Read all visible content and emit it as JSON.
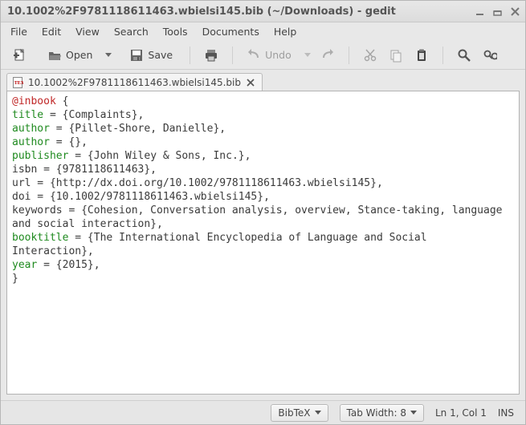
{
  "window": {
    "title": "10.1002%2F9781118611463.wbielsi145.bib (~/Downloads) - gedit"
  },
  "menubar": [
    "File",
    "Edit",
    "View",
    "Search",
    "Tools",
    "Documents",
    "Help"
  ],
  "toolbar": {
    "open_label": "Open",
    "save_label": "Save",
    "undo_label": "Undo"
  },
  "tab": {
    "filename": "10.1002%2F9781118611463.wbielsi145.bib"
  },
  "editor_tokens": [
    {
      "t": "@inbook",
      "c": "tok-at"
    },
    {
      "t": " {\n"
    },
    {
      "t": "title",
      "c": "tok-key"
    },
    {
      "t": " = {Complaints},\n"
    },
    {
      "t": "author",
      "c": "tok-key"
    },
    {
      "t": " = {Pillet-Shore, Danielle},\n"
    },
    {
      "t": "author",
      "c": "tok-key"
    },
    {
      "t": " = {},\n"
    },
    {
      "t": "publisher",
      "c": "tok-key"
    },
    {
      "t": " = {John Wiley & Sons, Inc.},\n"
    },
    {
      "t": "isbn = {9781118611463},\n"
    },
    {
      "t": "url = {http://dx.doi.org/10.1002/9781118611463.wbielsi145},\n"
    },
    {
      "t": "doi = {10.1002/9781118611463.wbielsi145},\n"
    },
    {
      "t": "keywords = {Cohesion, Conversation analysis, overview, Stance-taking, language and social interaction},\n"
    },
    {
      "t": "booktitle",
      "c": "tok-key"
    },
    {
      "t": " = {The International Encyclopedia of Language and Social Interaction},\n"
    },
    {
      "t": "year",
      "c": "tok-key"
    },
    {
      "t": " = {2015},\n"
    },
    {
      "t": "}\n"
    }
  ],
  "statusbar": {
    "syntax": "BibTeX",
    "tabwidth": "Tab Width: 8",
    "cursor": "Ln 1, Col 1",
    "insmode": "INS"
  }
}
